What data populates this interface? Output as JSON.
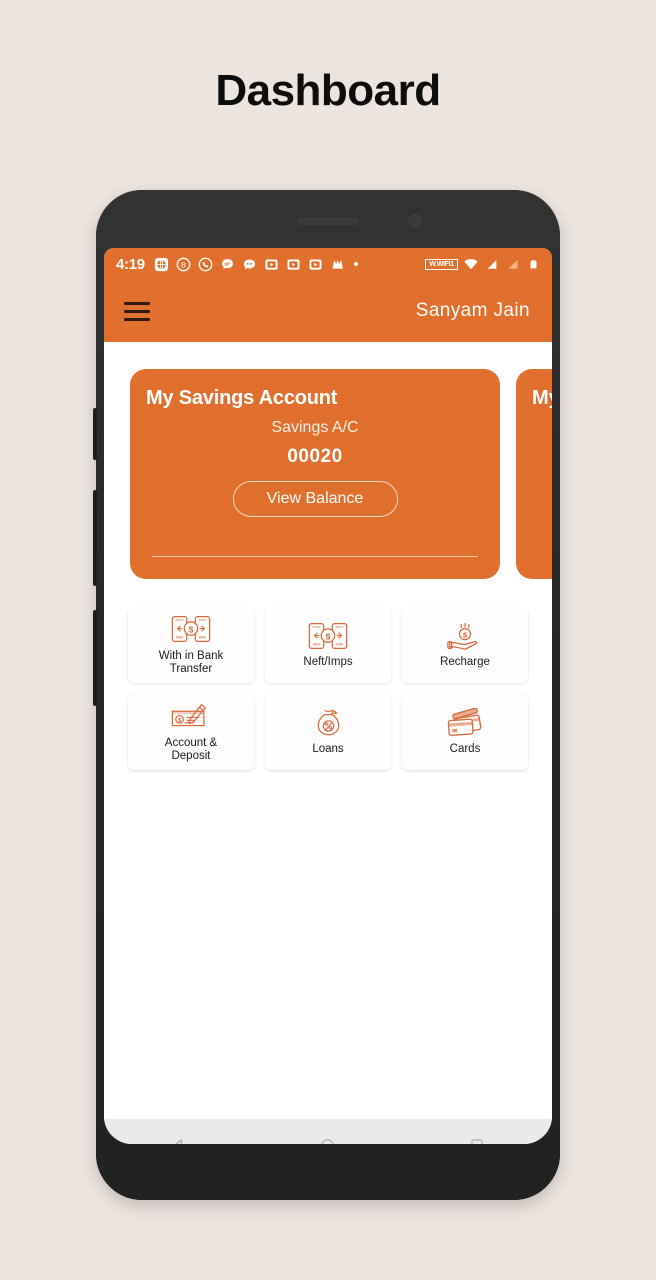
{
  "page": {
    "title": "Dashboard",
    "background_color": "#ece4df"
  },
  "device": {
    "bezel_color": "#2b2b2b"
  },
  "statusbar": {
    "time": "4:19",
    "wifi_label": "W.WIFI1",
    "app_icons": [
      "globe-app-icon",
      "b-circle-app-icon",
      "whatsapp-icon",
      "chat-bubble-icon",
      "messages-icon",
      "video-app-icon-1",
      "video-app-icon-2",
      "video-app-icon-3",
      "myntra-app-icon"
    ],
    "signal_icons": [
      "wifi-icon",
      "signal-bars-icon-1",
      "signal-bars-icon-2",
      "battery-icon"
    ]
  },
  "appbar": {
    "menu_icon": "hamburger-menu-icon",
    "username": "Sanyam Jain",
    "background_color": "#e1702f"
  },
  "account_cards": [
    {
      "title": "My Savings Account",
      "subtitle": "Savings A/C",
      "number": "00020",
      "button_label": "View Balance"
    },
    {
      "title": "My"
    }
  ],
  "tiles": [
    {
      "label": "With in Bank\nTransfer",
      "icon": "phone-transfer-icon"
    },
    {
      "label": "Neft/Imps",
      "icon": "phone-transfer-icon"
    },
    {
      "label": "Recharge",
      "icon": "hand-coin-icon"
    },
    {
      "label": "Account &\nDeposit",
      "icon": "cheque-pen-icon"
    },
    {
      "label": "Loans",
      "icon": "money-bag-percent-icon"
    },
    {
      "label": "Cards",
      "icon": "credit-cards-icon"
    }
  ],
  "navbar": {
    "back_label": "back-triangle-icon",
    "home_label": "home-circle-icon",
    "recents_label": "recents-square-icon"
  },
  "colors": {
    "accent": "#e1702f",
    "icon_stroke": "#d9683a",
    "background": "#ece4df"
  }
}
